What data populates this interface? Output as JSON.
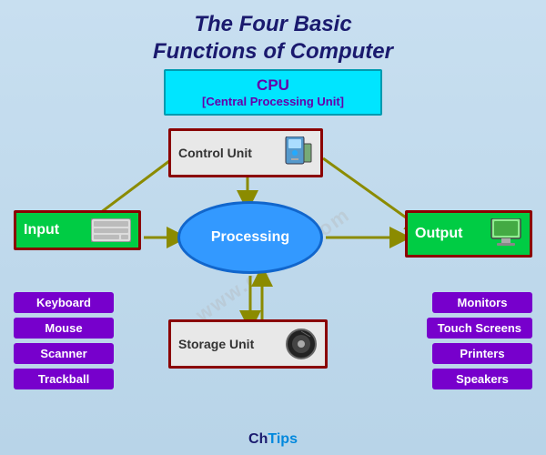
{
  "title": {
    "line1": "The Four Basic",
    "line2": "Functions of Computer"
  },
  "cpu": {
    "title": "CPU",
    "subtitle": "[Central Processing Unit]"
  },
  "controlUnit": {
    "label": "Control Unit"
  },
  "processing": {
    "label": "Processing"
  },
  "storageUnit": {
    "label": "Storage Unit"
  },
  "inputBox": {
    "label": "Input"
  },
  "outputBox": {
    "label": "Output"
  },
  "inputList": [
    {
      "label": "Keyboard"
    },
    {
      "label": "Mouse"
    },
    {
      "label": "Scanner"
    },
    {
      "label": "Trackball"
    }
  ],
  "outputList": [
    {
      "label": "Monitors"
    },
    {
      "label": "Touch Screens"
    },
    {
      "label": "Printers"
    },
    {
      "label": "Speakers"
    }
  ],
  "brand": {
    "ch": "Ch",
    "tips": "Tips"
  },
  "watermark": "www.chtips.com"
}
